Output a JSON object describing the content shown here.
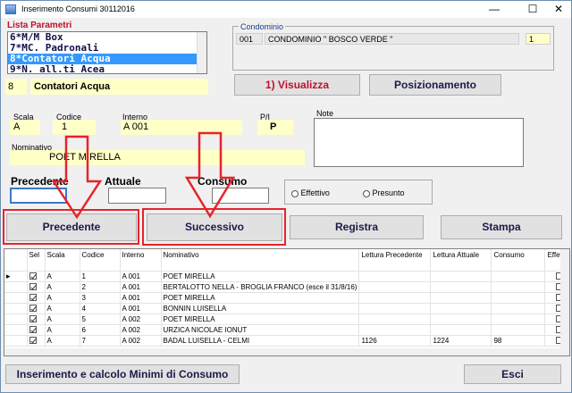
{
  "window": {
    "title": "Inserimento Consumi 30112016",
    "controls": {
      "minimize": "—",
      "maximize": "☐",
      "close": "✕"
    }
  },
  "parametri": {
    "label": "Lista Parametri",
    "items": [
      "6*M/M Box",
      "7*MC. Padronali",
      "8*Contatori Acqua",
      "9*N. all.ti Acea"
    ],
    "selected_index": 2,
    "code": "8",
    "description": "Contatori Acqua"
  },
  "condominio": {
    "label": "Condominio",
    "code": "001",
    "name": "CONDOMINIO \" BOSCO VERDE \"",
    "number": "1"
  },
  "buttons": {
    "visualizza": "1) Visualizza",
    "posizionamento": "Posizionamento",
    "precedente": "Precedente",
    "successivo": "Successivo",
    "registra": "Registra",
    "stampa": "Stampa",
    "minimi": "Inserimento e calcolo Minimi di Consumo",
    "esci": "Esci"
  },
  "fields": {
    "scala": {
      "label": "Scala",
      "value": "A"
    },
    "codice": {
      "label": "Codice",
      "value": "1"
    },
    "interno": {
      "label": "Interno",
      "value": "A 001"
    },
    "pi": {
      "label": "P/I",
      "value": "P"
    },
    "note": {
      "label": "Note",
      "value": ""
    },
    "nominativo": {
      "label": "Nominativo",
      "value": "POET MIRELLA"
    }
  },
  "letture": {
    "precedente_label": "Precedente",
    "attuale_label": "Attuale",
    "consumo_label": "Consumo",
    "effettivo_label": "Effettivo",
    "presunto_label": "Presunto"
  },
  "grid": {
    "columns": [
      "Sel",
      "Scala",
      "Codice",
      "Interno",
      "Nominativo",
      "Lettura Precedente",
      "Lettura Attuale",
      "Consumo",
      "Effett"
    ],
    "rows": [
      {
        "sel": true,
        "scala": "A",
        "codice": "1",
        "interno": "A 001",
        "nominativo": "POET MIRELLA",
        "prec": "",
        "att": "",
        "cons": ""
      },
      {
        "sel": true,
        "scala": "A",
        "codice": "2",
        "interno": "A 001",
        "nominativo": "BERTALOTTO NELLA - BROGLIA FRANCO (esce il 31/8/16)",
        "prec": "",
        "att": "",
        "cons": ""
      },
      {
        "sel": true,
        "scala": "A",
        "codice": "3",
        "interno": "A 001",
        "nominativo": "POET MIRELLA",
        "prec": "",
        "att": "",
        "cons": ""
      },
      {
        "sel": true,
        "scala": "A",
        "codice": "4",
        "interno": "A 001",
        "nominativo": "BONNIN LUISELLA",
        "prec": "",
        "att": "",
        "cons": ""
      },
      {
        "sel": true,
        "scala": "A",
        "codice": "5",
        "interno": "A 002",
        "nominativo": "POET MIRELLA",
        "prec": "",
        "att": "",
        "cons": ""
      },
      {
        "sel": true,
        "scala": "A",
        "codice": "6",
        "interno": "A 002",
        "nominativo": "URZICA NICOLAE IONUT",
        "prec": "",
        "att": "",
        "cons": ""
      },
      {
        "sel": true,
        "scala": "A",
        "codice": "7",
        "interno": "A 002",
        "nominativo": "BADAL LUISELLA - CELMI",
        "prec": "1126",
        "att": "1224",
        "cons": "98"
      }
    ]
  },
  "colors": {
    "accent_red": "#e5242b",
    "field_yellow": "#ffffc8",
    "selection_blue": "#3399ff"
  }
}
